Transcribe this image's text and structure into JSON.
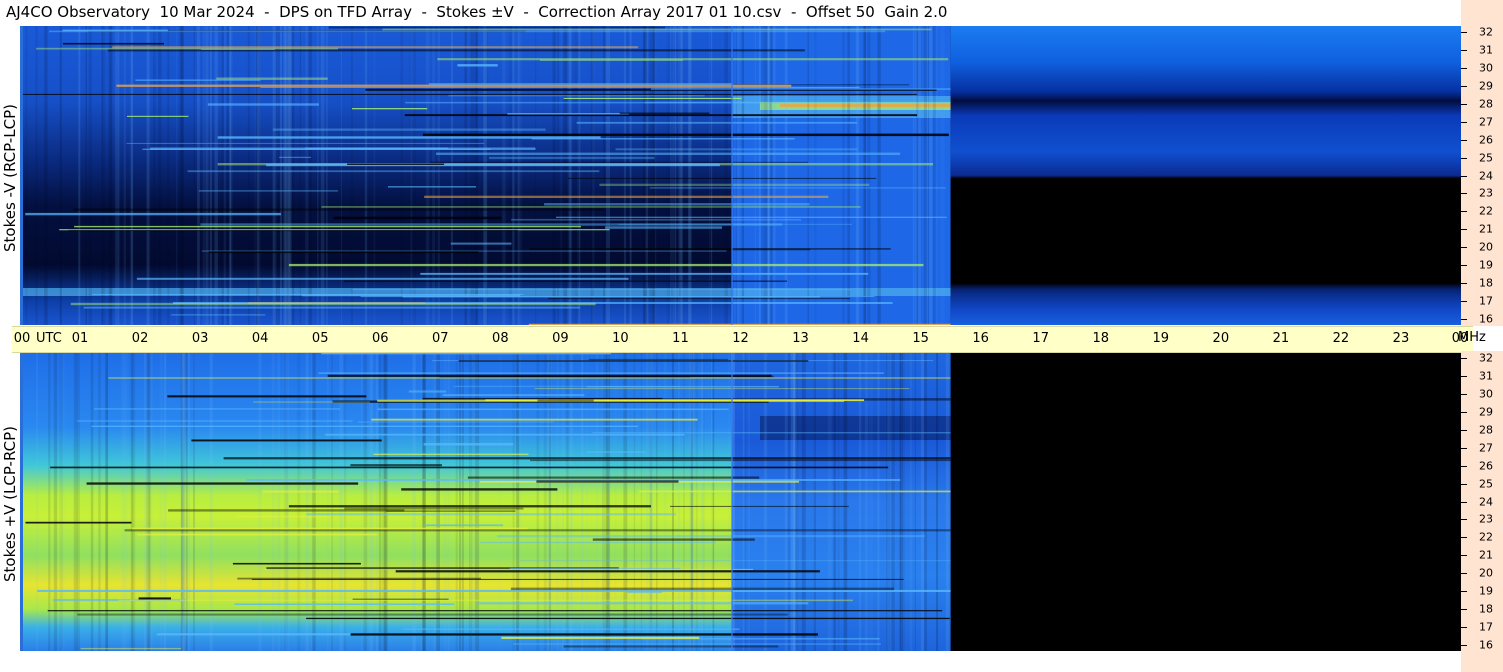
{
  "header": {
    "title": "AJ4CO Observatory  10 Mar 2024  -  DPS on TFD Array  -  Stokes ±V  -  Correction Array 2017 01 10.csv  -  Offset 50  Gain 2.0"
  },
  "chart_data": {
    "type": "heatmap",
    "title": "AJ4CO Observatory  10 Mar 2024  -  DPS on TFD Array  -  Stokes ±V  -  Correction Array 2017 01 10.csv  -  Offset 50  Gain 2.0",
    "x_axis": {
      "unit_label": "UTC",
      "ticks": [
        "00",
        "01",
        "02",
        "03",
        "04",
        "05",
        "06",
        "07",
        "08",
        "09",
        "10",
        "11",
        "12",
        "13",
        "14",
        "15",
        "16",
        "17",
        "18",
        "19",
        "20",
        "21",
        "22",
        "23",
        "00"
      ],
      "range_hours": [
        0,
        24
      ]
    },
    "y_axis": {
      "unit_label": "MHz",
      "ticks": [
        "32",
        "31",
        "30",
        "29",
        "28",
        "27",
        "26",
        "25",
        "24",
        "23",
        "22",
        "21",
        "20",
        "19",
        "18",
        "17",
        "16"
      ],
      "range_mhz": [
        16,
        32
      ]
    },
    "panels": [
      {
        "ylabel": "Stokes -V (RCP-LCP)",
        "data_end_hour": 15.5,
        "colors": {
          "background": "#000000",
          "low": "#02103a",
          "mid": "#1a5fe0",
          "high": "#9fe860",
          "peak": "#ff8a2a"
        }
      },
      {
        "ylabel": "Stokes +V (LCP-RCP)",
        "data_end_hour": 15.5,
        "colors": {
          "background": "#000000",
          "low": "#0a2a8a",
          "mid": "#2a7ff0",
          "high": "#b8ef3a",
          "peak": "#f2e02a"
        }
      }
    ]
  }
}
